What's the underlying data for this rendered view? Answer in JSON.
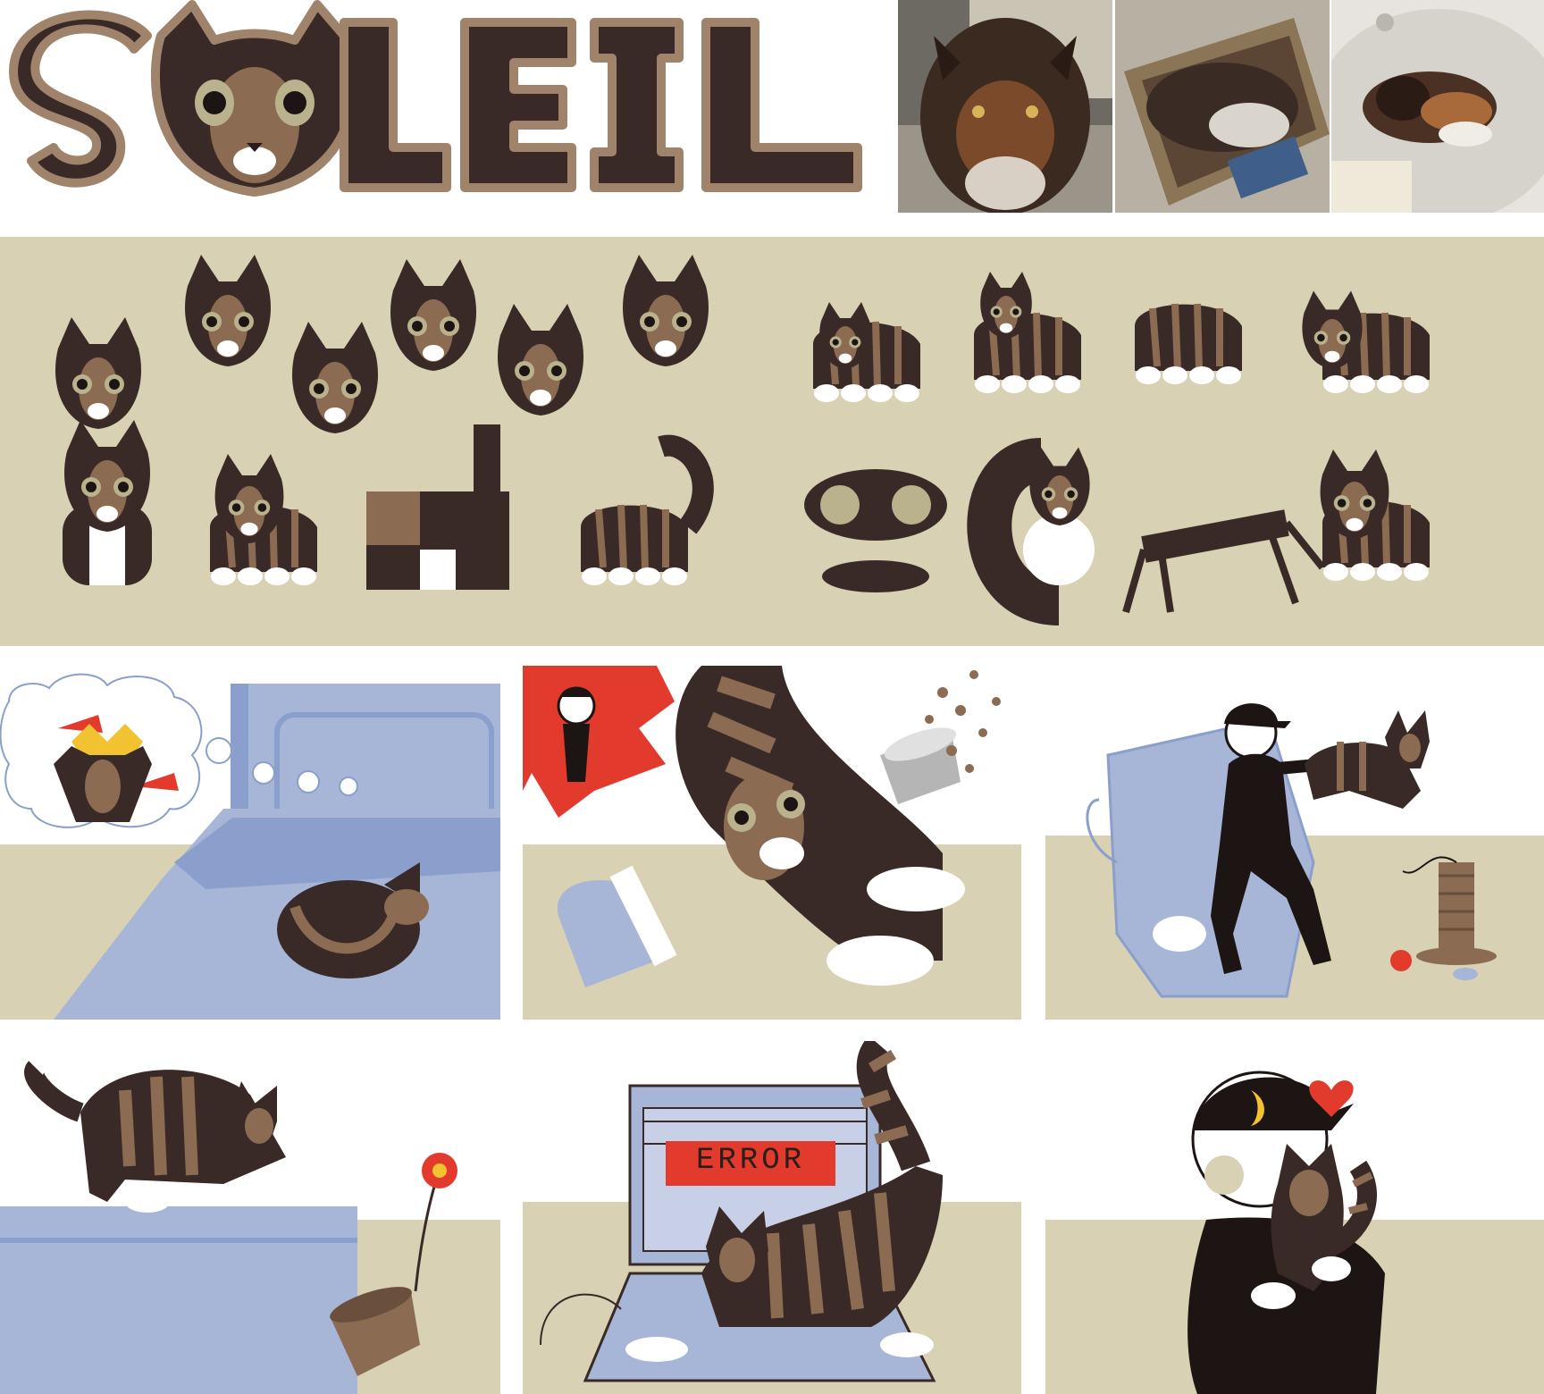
{
  "title": {
    "text": "SOLEIL"
  },
  "photos": [
    {
      "name": "cat-photo-laptop"
    },
    {
      "name": "cat-photo-basket"
    },
    {
      "name": "cat-photo-bathtub"
    }
  ],
  "panels": {
    "error_text": "ERROR"
  },
  "colors": {
    "cat_dark": "#3a2a27",
    "cat_stripe": "#8b6b52",
    "outline_tan": "#a0836b",
    "sheet_bg": "#d8d1b3",
    "floor": "#d8d1b3",
    "bed_blue": "#a7b5d6",
    "wall_blue": "#8a9fcb",
    "red": "#e23b2e",
    "white": "#ffffff"
  }
}
